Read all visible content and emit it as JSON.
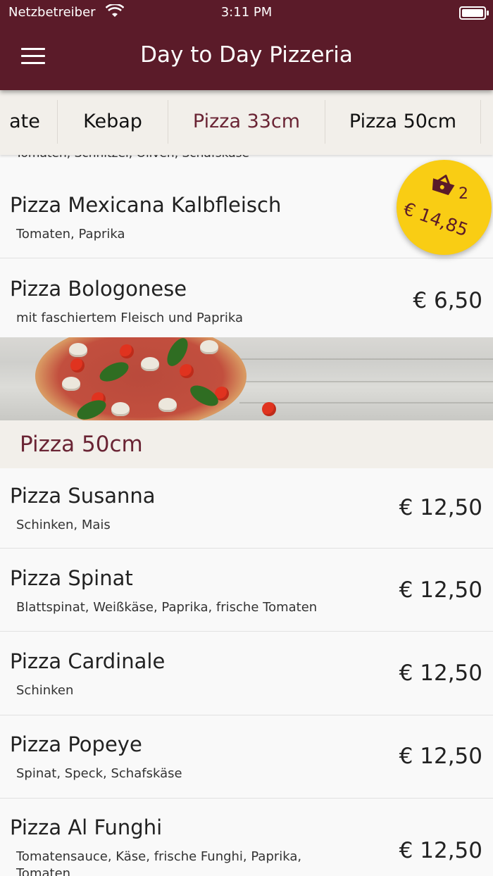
{
  "status_bar": {
    "carrier": "Netzbetreiber",
    "time": "3:11 PM"
  },
  "header": {
    "title": "Day to Day Pizzeria",
    "menu_icon": "hamburger-menu-icon"
  },
  "tabs": [
    {
      "label": "ate",
      "active": false
    },
    {
      "label": "Kebap",
      "active": false
    },
    {
      "label": "Pizza 33cm",
      "active": true
    },
    {
      "label": "Pizza 50cm",
      "active": false
    }
  ],
  "cut_item": {
    "description": "Tomaten, Schnitzel, Oliven, Schafskäse"
  },
  "items_33": [
    {
      "name": "Pizza Mexicana Kalbfleisch",
      "description": "Tomaten, Paprika",
      "price": ""
    },
    {
      "name": "Pizza Bologonese",
      "description": "mit faschiertem Fleisch und Paprika",
      "price": "€ 6,50"
    }
  ],
  "section": {
    "title": "Pizza 50cm"
  },
  "items_50": [
    {
      "name": "Pizza Susanna",
      "description": "Schinken, Mais",
      "price": "€ 12,50"
    },
    {
      "name": "Pizza Spinat",
      "description": "Blattspinat, Weißkäse, Paprika, frische Tomaten",
      "price": "€ 12,50"
    },
    {
      "name": "Pizza Cardinale",
      "description": "Schinken",
      "price": "€ 12,50"
    },
    {
      "name": "Pizza Popeye",
      "description": "Spinat, Speck, Schafskäse",
      "price": "€ 12,50"
    },
    {
      "name": "Pizza Al Funghi",
      "description": "Tomatensauce, Käse, frische Funghi, Paprika,",
      "description_line2": "Tomaten",
      "price": "€ 12,50"
    }
  ],
  "cart": {
    "count": "2",
    "total": "€ 14,85",
    "icon": "shopping-basket-icon"
  },
  "colors": {
    "primary": "#5b1b29",
    "accent_text": "#6a2434",
    "cart": "#f9cd14",
    "tab_bg": "#f2efea"
  }
}
